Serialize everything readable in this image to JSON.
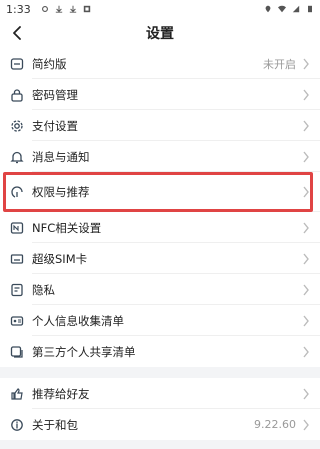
{
  "status": {
    "time": "1:33"
  },
  "header": {
    "title": "设置"
  },
  "section1": [
    {
      "name": "simple-mode",
      "label": "简约版",
      "value": "未开启"
    },
    {
      "name": "password-management",
      "label": "密码管理",
      "value": ""
    },
    {
      "name": "payment-settings",
      "label": "支付设置",
      "value": ""
    },
    {
      "name": "messages-notifications",
      "label": "消息与通知",
      "value": ""
    },
    {
      "name": "permissions-recommend",
      "label": "权限与推荐",
      "value": ""
    },
    {
      "name": "nfc-settings",
      "label": "NFC相关设置",
      "value": ""
    },
    {
      "name": "super-sim",
      "label": "超级SIM卡",
      "value": ""
    },
    {
      "name": "privacy",
      "label": "隐私",
      "value": ""
    },
    {
      "name": "personal-info-list",
      "label": "个人信息收集清单",
      "value": ""
    },
    {
      "name": "third-party-share-list",
      "label": "第三方个人共享清单",
      "value": ""
    }
  ],
  "section2": [
    {
      "name": "recommend-friends",
      "label": "推荐给好友",
      "value": ""
    },
    {
      "name": "about",
      "label": "关于和包",
      "value": "9.22.60"
    }
  ],
  "colors": {
    "highlight": "#e04444",
    "icon": "#3a4a5a",
    "chevron": "#bbbbbb"
  },
  "icons": {
    "section1": [
      "simple-icon",
      "lock-icon",
      "gear-icon",
      "bell-icon",
      "finger-icon",
      "nfc-icon",
      "sim-icon",
      "privacy-icon",
      "id-card-icon",
      "share-list-icon"
    ],
    "section2": [
      "thumbs-up-icon",
      "info-icon"
    ]
  }
}
